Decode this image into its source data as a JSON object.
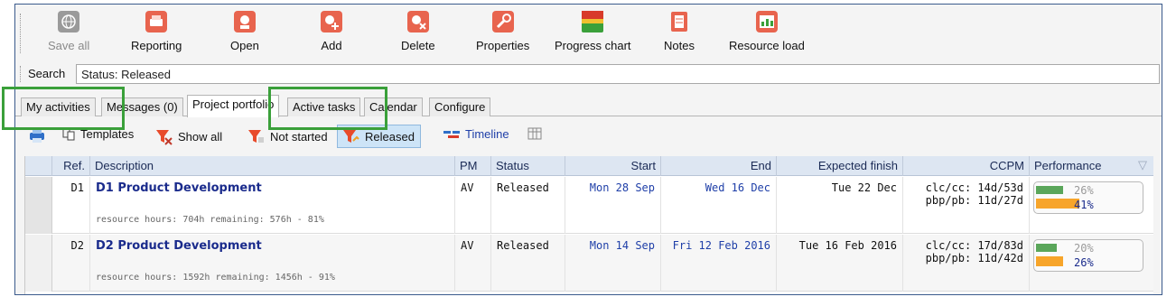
{
  "toolbar": {
    "buttons": [
      {
        "label": "Save all",
        "icon": "globe-save-icon",
        "disabled": true
      },
      {
        "label": "Reporting",
        "icon": "printer-icon"
      },
      {
        "label": "Open",
        "icon": "open-project-icon"
      },
      {
        "label": "Add",
        "icon": "add-project-icon"
      },
      {
        "label": "Delete",
        "icon": "delete-project-icon"
      },
      {
        "label": "Properties",
        "icon": "properties-icon"
      },
      {
        "label": "Progress chart",
        "icon": "progress-chart-icon"
      },
      {
        "label": "Notes",
        "icon": "notes-icon"
      },
      {
        "label": "Resource load",
        "icon": "resource-load-icon"
      }
    ]
  },
  "search": {
    "label": "Search",
    "value": "Status: Released"
  },
  "tabs": [
    "My activities",
    "Messages (0)",
    "Project portfolio",
    "Active tasks",
    "Calendar",
    "Configure"
  ],
  "active_tab": "Project portfolio",
  "subtoolbar": {
    "templates": "Templates",
    "show_all": "Show all",
    "not_started": "Not started",
    "released": "Released",
    "timeline": "Timeline"
  },
  "table": {
    "columns": [
      "Ref.",
      "Description",
      "PM",
      "Status",
      "Start",
      "End",
      "Expected finish",
      "CCPM",
      "Performance"
    ],
    "rows": [
      {
        "ref": "D1",
        "title": "D1 Product Development",
        "sub": "resource hours: 704h remaining: 576h - 81%",
        "pm": "AV",
        "status": "Released",
        "start": "Mon 28 Sep",
        "end": "Wed 16 Dec",
        "expected": "Tue 22 Dec",
        "ccpm1": "clc/cc: 14d/53d",
        "ccpm2": "pbp/pb: 11d/27d",
        "perf1": "26%",
        "perf2": "41%",
        "perf1_value": 0.26,
        "perf2_value": 0.41
      },
      {
        "ref": "D2",
        "title": "D2  Product Development",
        "sub": "resource hours: 1592h remaining: 1456h - 91%",
        "pm": "AV",
        "status": "Released",
        "start": "Mon 14 Sep",
        "end": "Fri 12 Feb 2016",
        "expected": "Tue 16 Feb 2016",
        "ccpm1": "clc/cc: 17d/83d",
        "ccpm2": "pbp/pb: 11d/42d",
        "perf1": "20%",
        "perf2": "26%",
        "perf1_value": 0.2,
        "perf2_value": 0.26
      }
    ]
  },
  "colors": {
    "highlight": "#3aa03a",
    "accent": "#1f3fa8",
    "header": "#dde6f2"
  }
}
